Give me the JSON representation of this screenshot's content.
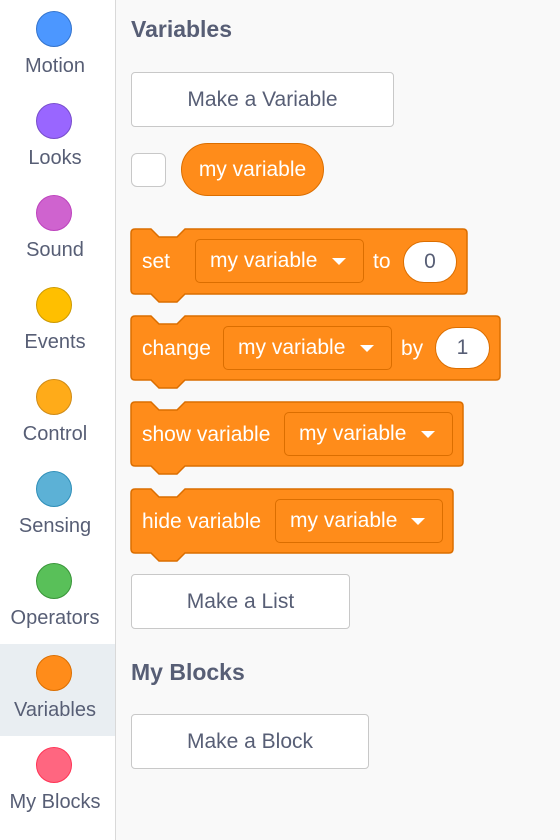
{
  "sidebar": {
    "categories": [
      {
        "label": "Motion",
        "color": "#4c97ff",
        "border": "#3373cc"
      },
      {
        "label": "Looks",
        "color": "#9966ff",
        "border": "#774dcb"
      },
      {
        "label": "Sound",
        "color": "#cf63cf",
        "border": "#bd42bd"
      },
      {
        "label": "Events",
        "color": "#ffbf00",
        "border": "#cc9900"
      },
      {
        "label": "Control",
        "color": "#ffab19",
        "border": "#cf8b17"
      },
      {
        "label": "Sensing",
        "color": "#5cb1d6",
        "border": "#2e8eb8"
      },
      {
        "label": "Operators",
        "color": "#59c059",
        "border": "#389438"
      },
      {
        "label": "Variables",
        "color": "#ff8c1a",
        "border": "#db6e00",
        "selected": true
      },
      {
        "label": "My Blocks",
        "color": "#ff6680",
        "border": "#ff3355"
      }
    ]
  },
  "palette": {
    "variables_heading": "Variables",
    "make_variable_label": "Make a Variable",
    "variable_reporter": "my variable",
    "blocks": {
      "set": {
        "label": "set",
        "variable": "my variable",
        "connector": "to",
        "value": "0"
      },
      "change": {
        "label": "change",
        "variable": "my variable",
        "connector": "by",
        "value": "1"
      },
      "show": {
        "label": "show variable",
        "variable": "my variable"
      },
      "hide": {
        "label": "hide variable",
        "variable": "my variable"
      }
    },
    "make_list_label": "Make a List",
    "my_blocks_heading": "My Blocks",
    "make_block_label": "Make a Block"
  },
  "colors": {
    "block_fill": "#ff8c1a",
    "block_border": "#db6e00",
    "text_dark": "#575e75"
  }
}
